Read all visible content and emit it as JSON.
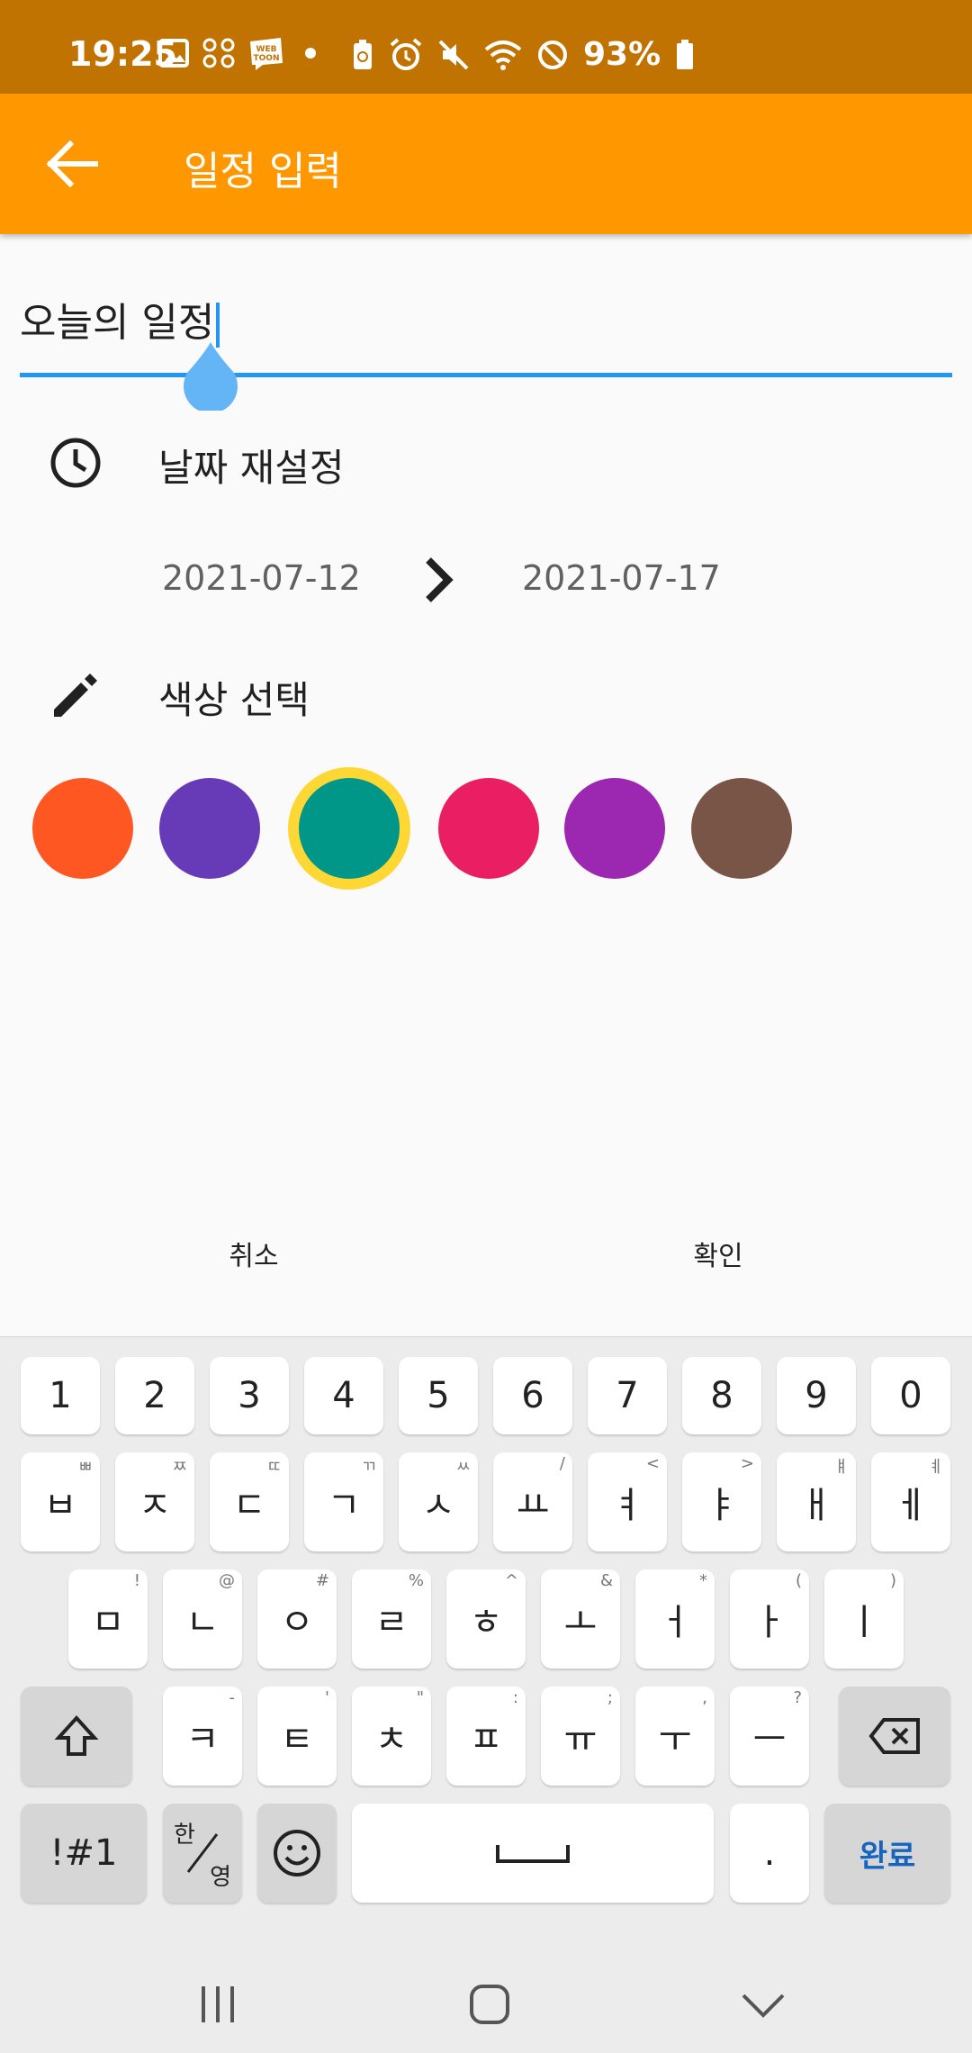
{
  "status_bar": {
    "time": "19:25",
    "battery_text": "93%",
    "icons": [
      "gallery-icon",
      "apps-icon",
      "webtoon-icon",
      "dot-icon",
      "battery-saver-icon",
      "alarm-icon",
      "mute-icon",
      "wifi-icon",
      "dnd-icon",
      "battery-icon"
    ],
    "webtoon_label": "WEB TOON"
  },
  "app_bar": {
    "title": "일정 입력",
    "back_icon": "arrow-back-icon"
  },
  "title_input": {
    "value": "오늘의 일정"
  },
  "date_section": {
    "icon": "clock-icon",
    "label": "날짜 재설정",
    "start_date": "2021-07-12",
    "end_date": "2021-07-17",
    "arrow_icon": "chevron-right-icon"
  },
  "color_section": {
    "icon": "pencil-icon",
    "label": "색상 선택",
    "colors": [
      "#ff5722",
      "#673ab7",
      "#009688",
      "#e91e63",
      "#9c27b0",
      "#795548"
    ],
    "selected_index": 2,
    "selected_ring_color": "#fdd835"
  },
  "actions": {
    "cancel_label": "취소",
    "confirm_label": "확인"
  },
  "keyboard": {
    "row_numbers": [
      "1",
      "2",
      "3",
      "4",
      "5",
      "6",
      "7",
      "8",
      "9",
      "0"
    ],
    "row1": [
      {
        "main": "ㅂ",
        "sub": "ㅃ"
      },
      {
        "main": "ㅈ",
        "sub": "ㅉ"
      },
      {
        "main": "ㄷ",
        "sub": "ㄸ"
      },
      {
        "main": "ㄱ",
        "sub": "ㄲ"
      },
      {
        "main": "ㅅ",
        "sub": "ㅆ"
      },
      {
        "main": "ㅛ",
        "sub": "/"
      },
      {
        "main": "ㅕ",
        "sub": "<"
      },
      {
        "main": "ㅑ",
        "sub": ">"
      },
      {
        "main": "ㅐ",
        "sub": "ㅒ"
      },
      {
        "main": "ㅔ",
        "sub": "ㅖ"
      }
    ],
    "row2": [
      {
        "main": "ㅁ",
        "sub": "!"
      },
      {
        "main": "ㄴ",
        "sub": "@"
      },
      {
        "main": "ㅇ",
        "sub": "#"
      },
      {
        "main": "ㄹ",
        "sub": "%"
      },
      {
        "main": "ㅎ",
        "sub": "^"
      },
      {
        "main": "ㅗ",
        "sub": "&"
      },
      {
        "main": "ㅓ",
        "sub": "*"
      },
      {
        "main": "ㅏ",
        "sub": "("
      },
      {
        "main": "ㅣ",
        "sub": ")"
      }
    ],
    "row3": [
      {
        "main": "ㅋ",
        "sub": "-"
      },
      {
        "main": "ㅌ",
        "sub": "'"
      },
      {
        "main": "ㅊ",
        "sub": "\""
      },
      {
        "main": "ㅍ",
        "sub": ":"
      },
      {
        "main": "ㅠ",
        "sub": ";"
      },
      {
        "main": "ㅜ",
        "sub": ","
      },
      {
        "main": "ㅡ",
        "sub": "?"
      }
    ],
    "symbols_label": "!#1",
    "lang_top": "한",
    "lang_bottom": "영",
    "period_label": ".",
    "done_label": "완료"
  },
  "nav_bar": {
    "icons": [
      "recent-apps-icon",
      "home-icon",
      "back-chevron-icon"
    ]
  }
}
